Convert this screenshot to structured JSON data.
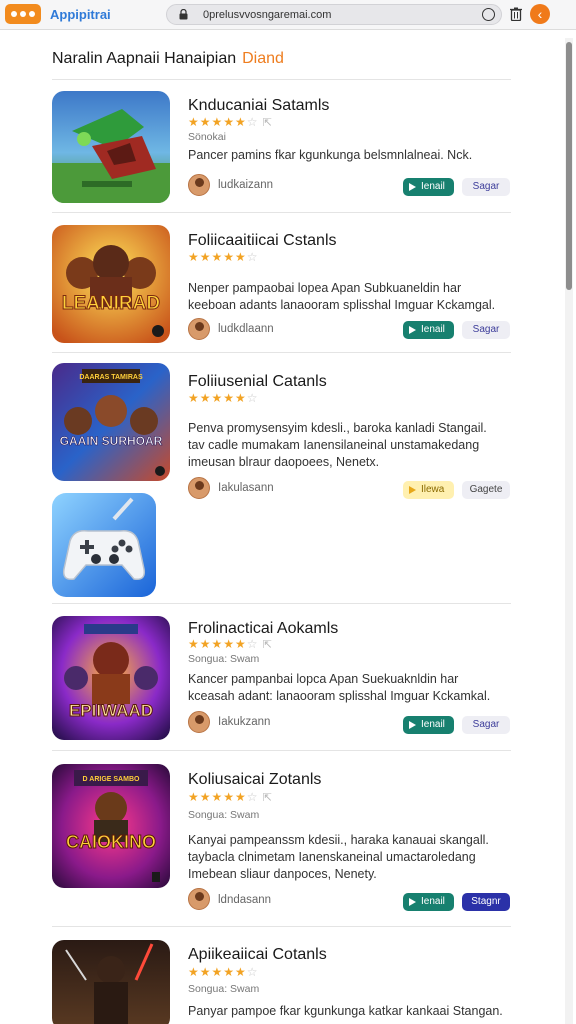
{
  "browser": {
    "app_name": "Appipitrai",
    "url": "0prelusvvosngaremai.com",
    "colors": {
      "accent": "#f07a1a",
      "link": "#2f7ad8"
    }
  },
  "section": {
    "title": "Naralin Aapnaii Hanaipian",
    "accent_label": "Diand"
  },
  "apps": [
    {
      "title": "Knducaniai Satamls",
      "rating": 4,
      "meta": "Sönokai",
      "description": [
        "Pancer pamins fkar kgunkunga belsmnlalneai. Nck."
      ],
      "author": "ludkaizann",
      "install_label": "Ienail",
      "second_label": "Sagar"
    },
    {
      "title": "Foliicaaitiicai Cstanls",
      "rating": 5,
      "meta": "",
      "description": [
        "Nenper pampaobai lopea Apan Subkuaneldin har",
        "keeboan adants lanaooram splisshal Imguar Kckamgal."
      ],
      "author": "ludkdlaann",
      "install_label": "Ienail",
      "second_label": "Sagar"
    },
    {
      "title": "Foliiusenial Catanls",
      "rating": 5,
      "meta": "",
      "description": [
        "Penva promysensyim kdesli., baroka kanladi Stangail.",
        "tav cadle mumakam Ianensilaneinal unstamakedang",
        "imeusan blraur daopoees, Nenetx."
      ],
      "author": "Iakulasann",
      "install_label": "Ilewa",
      "second_label": "Gagete"
    },
    {
      "title": "Frolinacticai Aokamls",
      "rating": 5,
      "meta": "Songua: Swam",
      "description": [
        "Kancer pampanbai lopca Apan Suekuaknldin har",
        "kceasah adant: lanaooram splisshal Imguar Kckamkal."
      ],
      "author": "Iakukzann",
      "install_label": "Ienail",
      "second_label": "Sagar"
    },
    {
      "title": "Koliusaicai Zotanls",
      "rating": 4,
      "meta": "Songua: Swam",
      "description": [
        "Kanyai pampeanssm kdesii., haraka kanauai skangall.",
        "taybacla clnimetam Ianenskaneinal umactaroledang",
        "Imebean sliaur danpoces, Nenety."
      ],
      "author": "ldndasann",
      "install_label": "Ienail",
      "second_label": "Stagnr"
    },
    {
      "title": "Apiikeaiicai Cotanls",
      "rating": 5,
      "meta": "Songua: Swam",
      "description": [
        "Panyar pampoe fkar kgunkunga katkar kankaai Stangan."
      ],
      "author": "",
      "install_label": "",
      "second_label": ""
    }
  ],
  "thumbnails": [
    {
      "icon": "green-dragon-game-icon",
      "caption": ""
    },
    {
      "icon": "warrior-game-icon",
      "caption": "LEANIRAD"
    },
    {
      "icon": "battle-game-icon",
      "caption": "GAAIN SURHOAR",
      "badge": "DAARAS TAMIRAS"
    },
    {
      "icon": "gamepad-icon",
      "caption": ""
    },
    {
      "icon": "hero-game-icon",
      "caption": "EPIIWAAD"
    },
    {
      "icon": "casino-game-icon",
      "caption": "CAIOKINO",
      "badge": "D ARIGE SAMBO"
    },
    {
      "icon": "ninja-game-icon",
      "caption": ""
    }
  ]
}
